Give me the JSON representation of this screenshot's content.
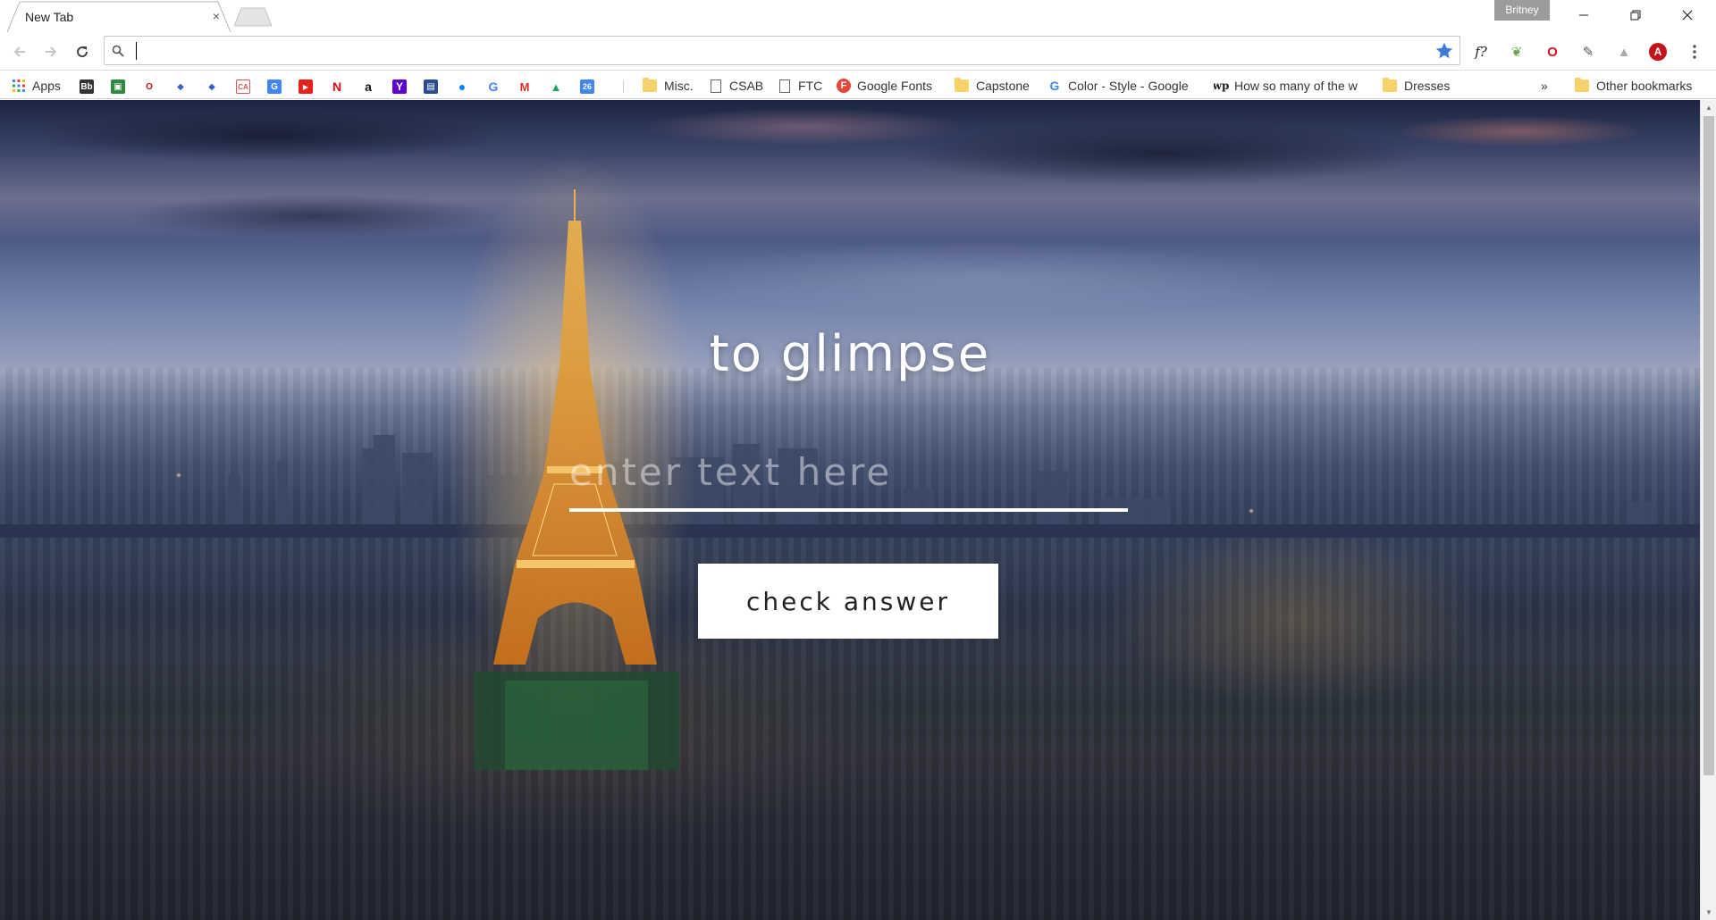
{
  "browser": {
    "tab_title": "New Tab",
    "tab_close": "×",
    "profile_name": "Britney",
    "omnibox_value": "",
    "bookmarks": {
      "apps_label": "Apps",
      "items": [
        {
          "label": "Misc.",
          "type": "folder"
        },
        {
          "label": "CSAB",
          "type": "page"
        },
        {
          "label": "FTC",
          "type": "page"
        },
        {
          "label": "Google Fonts",
          "type": "site",
          "icon_text": "F",
          "color": "#e8453c"
        },
        {
          "label": "Capstone",
          "type": "folder"
        },
        {
          "label": "Color - Style - Google",
          "type": "site",
          "icon_text": "G",
          "color": "#4285f4"
        },
        {
          "label": "How so many of the w",
          "type": "site",
          "icon_text": "wp",
          "color": "#222222"
        },
        {
          "label": "Dresses",
          "type": "folder"
        }
      ],
      "overflow": "»",
      "other_bookmarks": "Other bookmarks",
      "icon_bar": [
        {
          "name": "bb-icon",
          "text": "Bb",
          "color": "#333333"
        },
        {
          "name": "classroom-icon",
          "text": "▣",
          "color": "#2e8b3e"
        },
        {
          "name": "opera-icon",
          "text": "O",
          "color": "#cc0f16"
        },
        {
          "name": "diamond-icon-1",
          "text": "◆",
          "color": "#3a5fcd"
        },
        {
          "name": "diamond-icon-2",
          "text": "◆",
          "color": "#3a5fcd"
        },
        {
          "name": "ca-icon",
          "text": "CA",
          "color": "#d9534f"
        },
        {
          "name": "translate-icon",
          "text": "G",
          "color": "#4285f4"
        },
        {
          "name": "youtube-icon",
          "text": "▶",
          "color": "#e62117"
        },
        {
          "name": "netflix-icon",
          "text": "N",
          "color": "#e50914"
        },
        {
          "name": "amazon-icon",
          "text": "a",
          "color": "#111111"
        },
        {
          "name": "yahoo-icon",
          "text": "Y",
          "color": "#5f01d1"
        },
        {
          "name": "news-icon",
          "text": "▤",
          "color": "#2a4d8f"
        },
        {
          "name": "messenger-icon",
          "text": "●",
          "color": "#0084ff"
        },
        {
          "name": "google-icon",
          "text": "G",
          "color": "#4285f4"
        },
        {
          "name": "gmail-icon",
          "text": "M",
          "color": "#d93025"
        },
        {
          "name": "drive-icon",
          "text": "▲",
          "color": "#1fa463"
        },
        {
          "name": "calendar-icon",
          "text": "26",
          "color": "#4285f4"
        }
      ]
    },
    "extensions": [
      {
        "name": "font-extension-icon",
        "text": "f?"
      },
      {
        "name": "leaf-extension-icon",
        "text": "❦"
      },
      {
        "name": "opera-extension-icon",
        "text": "O"
      },
      {
        "name": "eyedropper-extension-icon",
        "text": "✎"
      },
      {
        "name": "drive-extension-icon",
        "text": "▲"
      },
      {
        "name": "adobe-extension-icon",
        "text": "A"
      }
    ]
  },
  "page": {
    "title": "to glimpse",
    "input_placeholder": "enter text here",
    "button_label": "check answer"
  }
}
